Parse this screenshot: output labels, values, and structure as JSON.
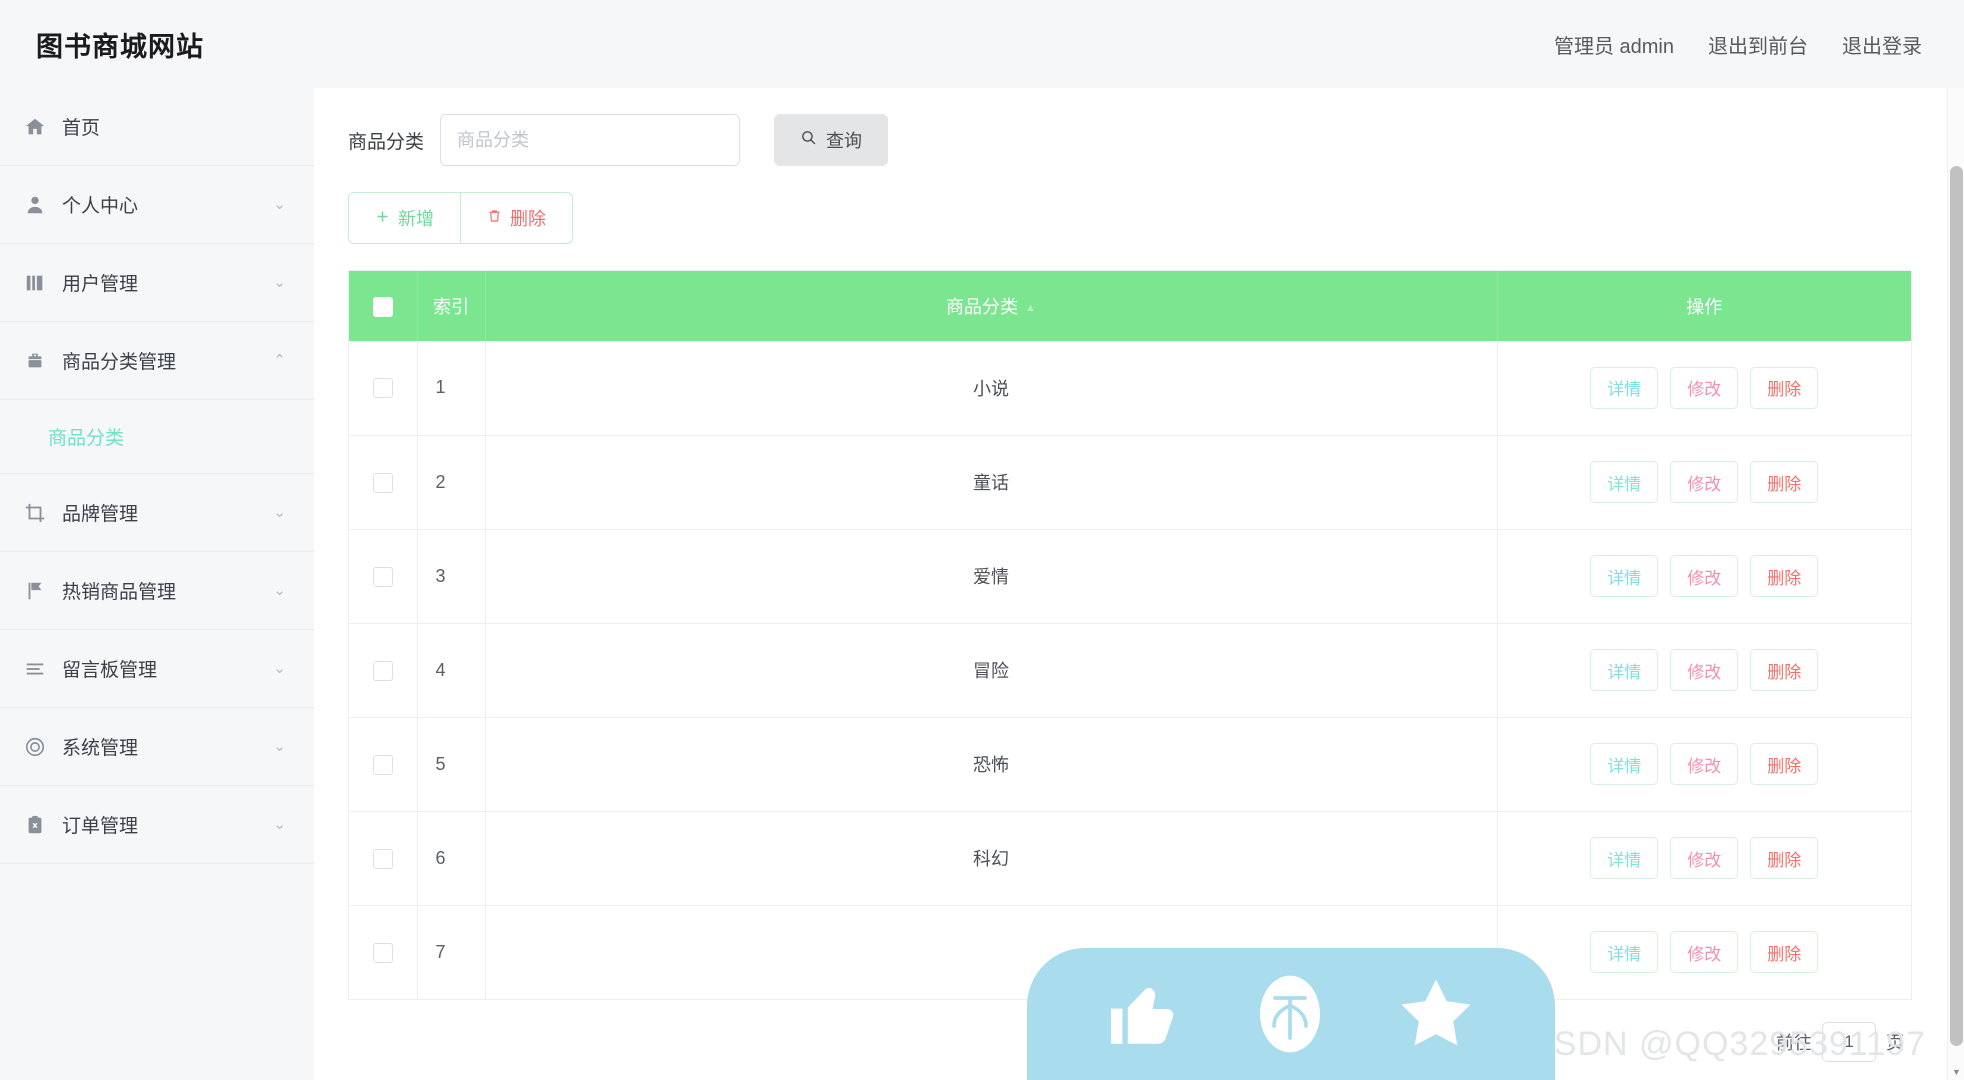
{
  "header": {
    "brand": "图书商城网站",
    "nav": [
      {
        "label": "管理员 admin",
        "name": "admin-user"
      },
      {
        "label": "退出到前台",
        "name": "exit-to-frontend"
      },
      {
        "label": "退出登录",
        "name": "logout"
      }
    ]
  },
  "sidebar": {
    "items": [
      {
        "label": "首页",
        "icon": "home-icon",
        "arrow": "",
        "expanded": false
      },
      {
        "label": "个人中心",
        "icon": "user-icon",
        "arrow": "⌄",
        "expanded": false
      },
      {
        "label": "用户管理",
        "icon": "book-icon",
        "arrow": "⌄",
        "expanded": false
      },
      {
        "label": "商品分类管理",
        "icon": "briefcase-icon",
        "arrow": "⌃",
        "expanded": true
      },
      {
        "label": "品牌管理",
        "icon": "crop-icon",
        "arrow": "⌄",
        "expanded": false
      },
      {
        "label": "热销商品管理",
        "icon": "flag-icon",
        "arrow": "⌄",
        "expanded": false
      },
      {
        "label": "留言板管理",
        "icon": "list-icon",
        "arrow": "⌄",
        "expanded": false
      },
      {
        "label": "系统管理",
        "icon": "target-icon",
        "arrow": "⌄",
        "expanded": false
      },
      {
        "label": "订单管理",
        "icon": "clipboard-icon",
        "arrow": "⌄",
        "expanded": false
      }
    ],
    "submenu": {
      "label": "商品分类",
      "parent_index": 3
    }
  },
  "filter": {
    "label": "商品分类",
    "placeholder": "商品分类",
    "value": "",
    "search_button": "查询",
    "search_icon": "search-icon"
  },
  "toolbar": {
    "add_label": "新增",
    "add_icon": "plus-icon",
    "delete_label": "删除",
    "delete_icon": "trash-icon"
  },
  "table": {
    "columns": [
      {
        "key": "check",
        "label": "",
        "name": "select-all-checkbox"
      },
      {
        "key": "index",
        "label": "索引"
      },
      {
        "key": "category",
        "label": "商品分类",
        "sortable": true
      },
      {
        "key": "operation",
        "label": "操作"
      }
    ],
    "rows": [
      {
        "index": "1",
        "category": "小说"
      },
      {
        "index": "2",
        "category": "童话"
      },
      {
        "index": "3",
        "category": "爱情"
      },
      {
        "index": "4",
        "category": "冒险"
      },
      {
        "index": "5",
        "category": "恐怖"
      },
      {
        "index": "6",
        "category": "科幻"
      },
      {
        "index": "7",
        "category": ""
      }
    ],
    "row_actions": {
      "detail": "详情",
      "edit": "修改",
      "delete": "删除"
    }
  },
  "pagination": {
    "goto_prefix": "前往",
    "page_value": "1",
    "goto_suffix": "页"
  },
  "float_bar": {
    "actions": [
      {
        "name": "thumbs-up-icon"
      },
      {
        "name": "csdn-logo-icon"
      },
      {
        "name": "star-icon"
      }
    ],
    "color": "#a9dced"
  },
  "watermark": {
    "text": "CSDN @QQ3295391197"
  },
  "colors": {
    "table_header_green": "#7ce58f",
    "submenu_active": "#6ee2c8",
    "danger": "#f56c6c",
    "success": "#6fd79a"
  }
}
